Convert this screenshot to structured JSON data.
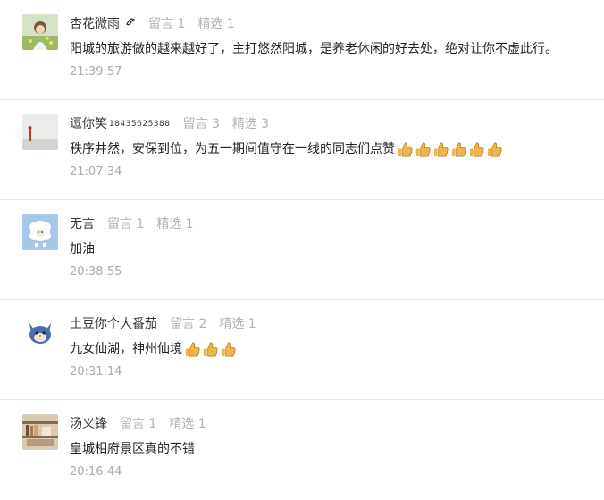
{
  "comments": [
    {
      "nickname": "杏花微雨",
      "nickname_suffix": "",
      "nickname_icon": "swirl-icon",
      "leave_count": "留言 1",
      "pick_count": "精选 1",
      "text": "阳城的旅游做的越来越好了，主打悠然阳城，是养老休闲的好去处，绝对让你不虚此行。",
      "thumbs": 0,
      "time": "21:39:57",
      "avatar": "girl-in-field-avatar"
    },
    {
      "nickname": "逗你笑",
      "nickname_suffix": "18435625388",
      "nickname_icon": "",
      "leave_count": "留言 3",
      "pick_count": "精选 3",
      "text": "秩序井然，安保到位，为五一期间值守在一线的同志们点赞",
      "thumbs": 6,
      "time": "21:07:34",
      "avatar": "sunset-silhouette-avatar"
    },
    {
      "nickname": "无言",
      "nickname_suffix": "",
      "nickname_icon": "",
      "leave_count": "留言 1",
      "pick_count": "精选 1",
      "text": "加油",
      "thumbs": 0,
      "time": "20:38:55",
      "avatar": "cartoon-sheep-avatar"
    },
    {
      "nickname": "土豆你个大番茄",
      "nickname_suffix": "",
      "nickname_icon": "",
      "leave_count": "留言 2",
      "pick_count": "精选 1",
      "text": "九女仙湖，神州仙境",
      "thumbs": 3,
      "time": "20:31:14",
      "avatar": "cartoon-cat-avatar"
    },
    {
      "nickname": "汤义锋",
      "nickname_suffix": "",
      "nickname_icon": "",
      "leave_count": "留言 1",
      "pick_count": "精选 1",
      "text": "皇城相府景区真的不错",
      "thumbs": 0,
      "time": "20:16:44",
      "avatar": "bookshelf-avatar"
    }
  ],
  "colors": {
    "nickname": "#333333",
    "stat": "#b2b2b2",
    "body_text": "#222222",
    "time": "#aaaaaa",
    "divider": "#e6e6e6",
    "thumb": "#f0b54a"
  }
}
